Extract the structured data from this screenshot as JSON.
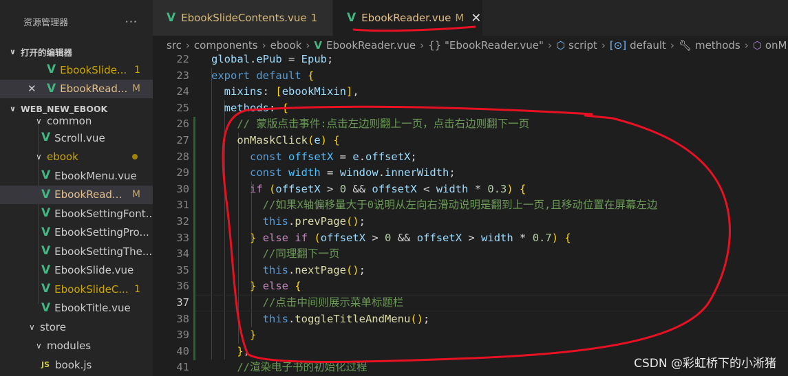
{
  "explorer": {
    "title": "资源管理器",
    "more": "···",
    "open_editors_label": "打开的编辑器",
    "open_editors": [
      {
        "name": "EbookSlide...",
        "badge": "1"
      },
      {
        "name": "EbookRead...",
        "badge": "M",
        "close": "✕"
      }
    ],
    "project_label": "WEB_NEW_EBOOK",
    "tree": [
      {
        "name": "common",
        "type": "folder"
      },
      {
        "name": "Scroll.vue",
        "type": "vue"
      },
      {
        "name": "ebook",
        "type": "folder"
      },
      {
        "name": "EbookMenu.vue",
        "type": "vue"
      },
      {
        "name": "EbookRead...",
        "type": "vue",
        "badge": "M"
      },
      {
        "name": "EbookSettingFont...",
        "type": "vue"
      },
      {
        "name": "EbookSettingPro...",
        "type": "vue"
      },
      {
        "name": "EbookSettingThe...",
        "type": "vue"
      },
      {
        "name": "EbookSlide.vue",
        "type": "vue"
      },
      {
        "name": "EbookSlideC...",
        "type": "vue",
        "badge": "1"
      },
      {
        "name": "EbookTitle.vue",
        "type": "vue"
      },
      {
        "name": "store",
        "type": "folder"
      },
      {
        "name": "modules",
        "type": "folder"
      },
      {
        "name": "book.js",
        "type": "js",
        "icon_text": "JS"
      }
    ]
  },
  "tabs": [
    {
      "label": "EbookSlideContents.vue",
      "badge": "1"
    },
    {
      "label": "EbookReader.vue",
      "badge": "M",
      "close": "✕"
    }
  ],
  "breadcrumb": {
    "items": [
      "src",
      "components",
      "ebook",
      "EbookReader.vue",
      "{} \"EbookReader.vue\"",
      "script",
      "default",
      "methods",
      "onM"
    ],
    "sep": "›"
  },
  "editor": {
    "current_line": "37",
    "lines": [
      {
        "no": "22",
        "text": "global.ePub = Epub;"
      },
      {
        "no": "23",
        "text": "export default {"
      },
      {
        "no": "24",
        "text": "  mixins: [ebookMixin],"
      },
      {
        "no": "25",
        "text": "  methods: {"
      },
      {
        "no": "26",
        "text": "    // 蒙版点击事件:点击左边则翻上一页，点击右边则翻下一页"
      },
      {
        "no": "27",
        "text": "    onMaskClick(e) {"
      },
      {
        "no": "28",
        "text": "      const offsetX = e.offsetX;"
      },
      {
        "no": "29",
        "text": "      const width = window.innerWidth;"
      },
      {
        "no": "30",
        "text": "      if (offsetX > 0 && offsetX < width * 0.3) {"
      },
      {
        "no": "31",
        "text": "        //如果X轴偏移量大于0说明从左向右滑动说明是翻到上一页,且移动位置在屏幕左边"
      },
      {
        "no": "32",
        "text": "        this.prevPage();"
      },
      {
        "no": "33",
        "text": "      } else if (offsetX > 0 && offsetX > width * 0.7) {"
      },
      {
        "no": "34",
        "text": "        //同理翻下一页"
      },
      {
        "no": "35",
        "text": "        this.nextPage();"
      },
      {
        "no": "36",
        "text": "      } else {"
      },
      {
        "no": "37",
        "text": "        //点击中间则展示菜单标题栏"
      },
      {
        "no": "38",
        "text": "        this.toggleTitleAndMenu();"
      },
      {
        "no": "39",
        "text": "      }"
      },
      {
        "no": "40",
        "text": "    },"
      },
      {
        "no": "41",
        "text": "    //渲染电子书的初始化过程"
      }
    ]
  },
  "watermark": "CSDN @彩虹桥下的小淅猪",
  "colors": {
    "vue_icon": "#41b883",
    "modified": "#c1a36a",
    "warning": "#cca700",
    "annotation": "#e81123"
  }
}
